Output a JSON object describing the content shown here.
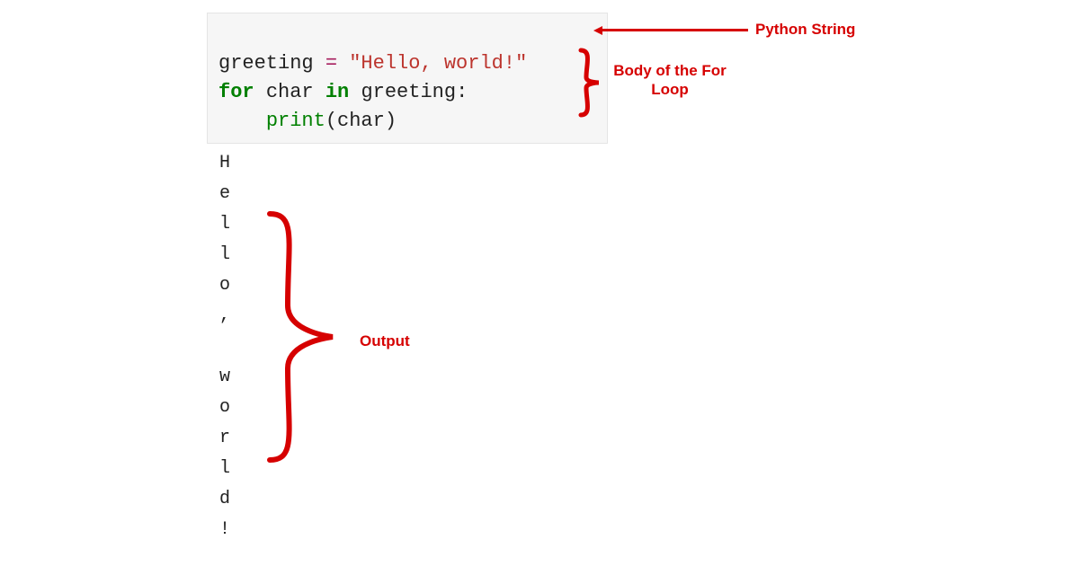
{
  "code": {
    "line1": {
      "var": "greeting",
      "eq": " = ",
      "str": "\"Hello, world!\""
    },
    "line2": {
      "kw_for": "for",
      "sp1": " ",
      "var1": "char",
      "sp2": " ",
      "kw_in": "in",
      "sp3": " ",
      "var2": "greeting",
      "colon": ":"
    },
    "line3": {
      "indent": "    ",
      "func": "print",
      "lp": "(",
      "arg": "char",
      "rp": ")"
    }
  },
  "output_lines": "H\ne\nl\nl\no\n,\n \nw\no\nr\nl\nd\n!",
  "annotations": {
    "python_string": "Python String",
    "body_loop": "Body of the For Loop",
    "output": "Output"
  }
}
